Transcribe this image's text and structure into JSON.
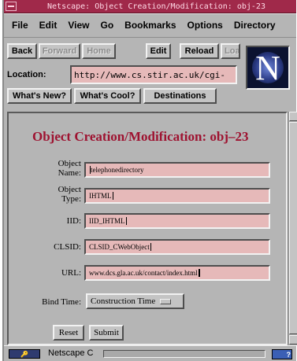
{
  "window": {
    "title": "Netscape: Object Creation/Modification: obj-23"
  },
  "menubar": {
    "items": [
      "File",
      "Edit",
      "View",
      "Go",
      "Bookmarks",
      "Options",
      "Directory"
    ]
  },
  "toolbar": {
    "back": "Back",
    "forward": "Forward",
    "home": "Home",
    "edit": "Edit",
    "reload": "Reload",
    "load": "Loa"
  },
  "location": {
    "label": "Location:",
    "url": "http://www.cs.stir.ac.uk/cgi-"
  },
  "directory_buttons": {
    "whats_new": "What's New?",
    "whats_cool": "What's Cool?",
    "destinations": "Destinations"
  },
  "logo": {
    "letter": "N"
  },
  "page": {
    "heading": "Object Creation/Modification: obj–23"
  },
  "form": {
    "object_name": {
      "label_line1": "Object",
      "label_line2": "Name:",
      "value": "telephonedirectory"
    },
    "object_type": {
      "label_line1": "Object",
      "label_line2": "Type:",
      "value": "IHTML"
    },
    "iid": {
      "label": "IID:",
      "value": "IID_IHTML"
    },
    "clsid": {
      "label": "CLSID:",
      "value": "CLSID_CWebObject"
    },
    "url": {
      "label": "URL:",
      "value": "www.dcs.gla.ac.uk/contact/index.html"
    },
    "bind_time": {
      "label": "Bind Time:",
      "selected": "Construction Time"
    },
    "reset_label": "Reset",
    "submit_label": "Submit"
  },
  "status": {
    "text": "Netscape C",
    "progress": 0.0
  },
  "colors": {
    "title_bar": "#a0294a",
    "heading": "#9e1230",
    "field_bg": "#e6b9b9",
    "chrome": "#b5b5b5"
  }
}
